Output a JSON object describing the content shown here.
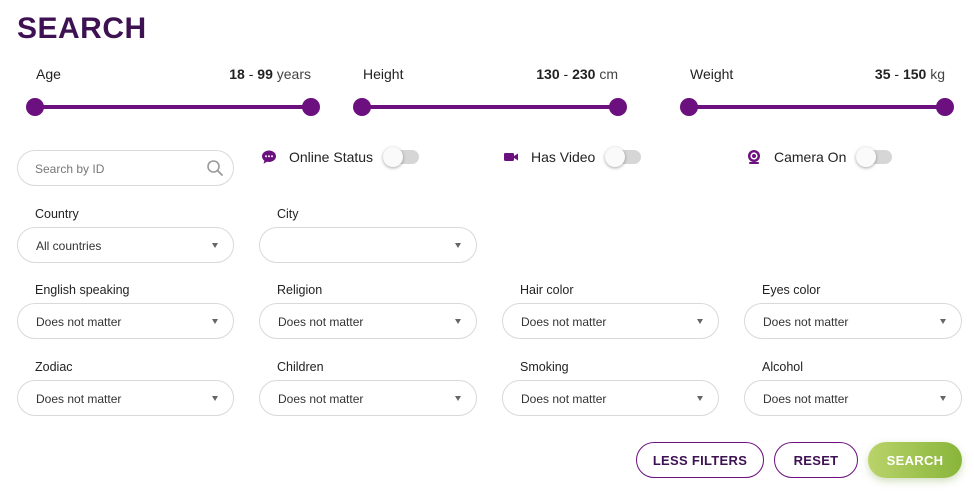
{
  "page": {
    "title": "SEARCH"
  },
  "ranges": [
    {
      "label": "Age",
      "min": "18",
      "sep": " - ",
      "max": "99",
      "unit": " years"
    },
    {
      "label": "Height",
      "min": "130",
      "sep": " - ",
      "max": "230",
      "unit": " cm"
    },
    {
      "label": "Weight",
      "min": "35",
      "sep": " - ",
      "max": "150",
      "unit": " kg"
    }
  ],
  "search": {
    "placeholder": "Search by ID",
    "value": ""
  },
  "toggles": [
    {
      "label": "Online Status",
      "icon": "chat-bubble-icon",
      "on": false
    },
    {
      "label": "Has Video",
      "icon": "video-camera-icon",
      "on": false
    },
    {
      "label": "Camera On",
      "icon": "webcam-icon",
      "on": false
    }
  ],
  "filters": {
    "country": {
      "label": "Country",
      "value": "All countries"
    },
    "city": {
      "label": "City",
      "value": ""
    },
    "english": {
      "label": "English speaking",
      "value": "Does not matter"
    },
    "religion": {
      "label": "Religion",
      "value": "Does not matter"
    },
    "hair": {
      "label": "Hair color",
      "value": "Does not matter"
    },
    "eyes": {
      "label": "Eyes color",
      "value": "Does not matter"
    },
    "zodiac": {
      "label": "Zodiac",
      "value": "Does not matter"
    },
    "children": {
      "label": "Children",
      "value": "Does not matter"
    },
    "smoking": {
      "label": "Smoking",
      "value": "Does not matter"
    },
    "alcohol": {
      "label": "Alcohol",
      "value": "Does not matter"
    }
  },
  "buttons": {
    "less_filters": "LESS FILTERS",
    "reset": "RESET",
    "search": "SEARCH"
  },
  "colors": {
    "accent": "#6c0f7f",
    "title": "#3d1152",
    "primary_start": "#b9d36a",
    "primary_end": "#88b53a"
  }
}
